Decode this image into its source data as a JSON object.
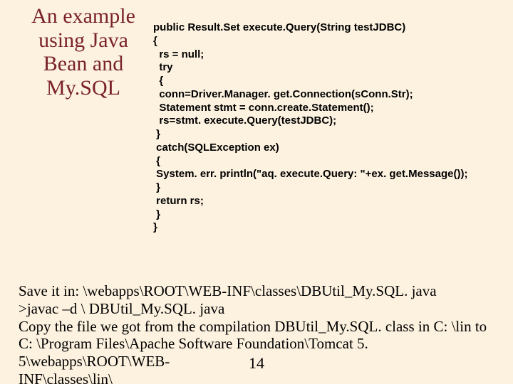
{
  "title": "An example using Java Bean and My.SQL",
  "code": {
    "l1": "public Result.Set execute.Query(String testJDBC)",
    "l2": "{",
    "l3": "  rs = null;",
    "l4": "  try",
    "l5": "  {",
    "l6": "  conn=Driver.Manager. get.Connection(sConn.Str);",
    "l7": "  Statement stmt = conn.create.Statement();",
    "l8": "  rs=stmt. execute.Query(testJDBC);",
    "l9": " }",
    "l10": " catch(SQLException ex)",
    "l11": " {",
    "l12": " System. err. println(\"aq. execute.Query: \"+ex. get.Message());",
    "l13": " }",
    "l14": " return rs;",
    "l15": " }",
    "l16": "}"
  },
  "instructions": {
    "l1": "Save it in: \\webapps\\ROOT\\WEB-INF\\classes\\DBUtil_My.SQL. java",
    "l2": ">javac –d \\ DBUtil_My.SQL. java",
    "l3": "Copy the file we got from the compilation DBUtil_My.SQL. class in C: \\lin   to",
    "l4": "C: \\Program Files\\Apache Software Foundation\\Tomcat 5. 5\\webapps\\ROOT\\WEB-",
    "l5": "INF\\classes\\lin\\"
  },
  "page_number": "14"
}
